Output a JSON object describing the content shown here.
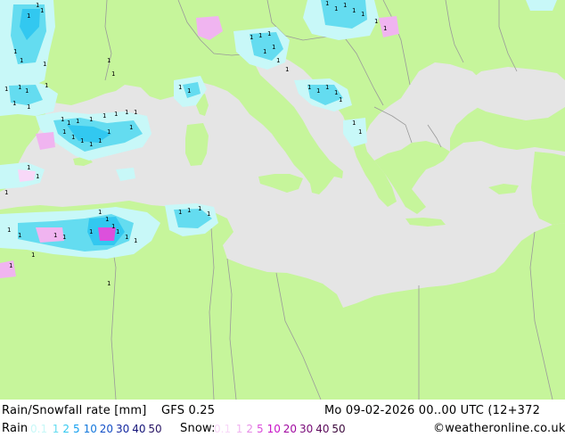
{
  "title": {
    "product": "Rain/Snowfall rate [mm]",
    "model": "GFS 0.25",
    "datetime": "Mo 09-02-2026 00..00 UTC (12+372"
  },
  "legend": {
    "rain_label": "Rain",
    "rain_values": [
      {
        "text": "0.1",
        "color": "#c8f8f8"
      },
      {
        "text": "1",
        "color": "#64dcf0"
      },
      {
        "text": "2",
        "color": "#32c8f0"
      },
      {
        "text": "5",
        "color": "#14a0f0"
      },
      {
        "text": "10",
        "color": "#1478dc"
      },
      {
        "text": "20",
        "color": "#1450c8"
      },
      {
        "text": "30",
        "color": "#1428a0"
      },
      {
        "text": "40",
        "color": "#141478"
      },
      {
        "text": "50",
        "color": "#281464"
      }
    ],
    "snow_label": "Snow:",
    "snow_values": [
      {
        "text": "0.1",
        "color": "#f8d8f8"
      },
      {
        "text": "1",
        "color": "#f0b4f0"
      },
      {
        "text": "2",
        "color": "#e68ce6"
      },
      {
        "text": "5",
        "color": "#dc50dc"
      },
      {
        "text": "10",
        "color": "#c814c8"
      },
      {
        "text": "20",
        "color": "#a00aa0"
      },
      {
        "text": "30",
        "color": "#780a78"
      },
      {
        "text": "40",
        "color": "#5a0a5a"
      },
      {
        "text": "50",
        "color": "#3c0a3c"
      }
    ],
    "credit": "©weatheronline.co.uk"
  },
  "colors": {
    "sea": "#e5e5e5",
    "land": "#c6f59b",
    "border": "#9a9a9a",
    "rain_light": "#c8f8f8",
    "rain_mid": "#64dcf0",
    "snow_light": "#f8d8f8",
    "snow_mid": "#f0b4f0",
    "marker": "#000000"
  }
}
